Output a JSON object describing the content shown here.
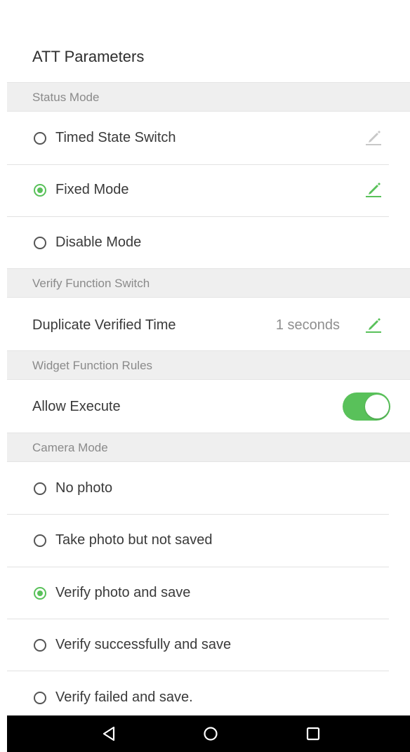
{
  "header": {
    "title": "ATT Parameters"
  },
  "status_mode": {
    "section_label": "Status Mode",
    "options": [
      {
        "label": "Timed State Switch",
        "checked": false,
        "edit_icon": "pencil-icon",
        "edit_enabled": false
      },
      {
        "label": "Fixed Mode",
        "checked": true,
        "edit_icon": "pencil-icon",
        "edit_enabled": true
      },
      {
        "label": "Disable Mode",
        "checked": false
      }
    ]
  },
  "verify_function": {
    "section_label": "Verify Function Switch",
    "duplicate_label": "Duplicate Verified Time",
    "duplicate_value": "1 seconds"
  },
  "widget_rules": {
    "section_label": "Widget Function Rules",
    "allow_execute_label": "Allow Execute",
    "allow_execute_on": true
  },
  "camera_mode": {
    "section_label": "Camera Mode",
    "options": [
      {
        "label": "No photo",
        "checked": false
      },
      {
        "label": "Take photo but not saved",
        "checked": false
      },
      {
        "label": "Verify photo and save",
        "checked": true
      },
      {
        "label": "Verify successfully and save",
        "checked": false
      },
      {
        "label": "Verify failed and save.",
        "checked": false
      }
    ]
  },
  "navbar": {
    "buttons": [
      "back-triangle-icon",
      "home-circle-icon",
      "recents-square-icon"
    ]
  },
  "colors": {
    "accent": "#59c15a",
    "section_bg": "#efefef",
    "disabled_icon": "#c8c8c8",
    "navbar_bg": "#000000"
  }
}
